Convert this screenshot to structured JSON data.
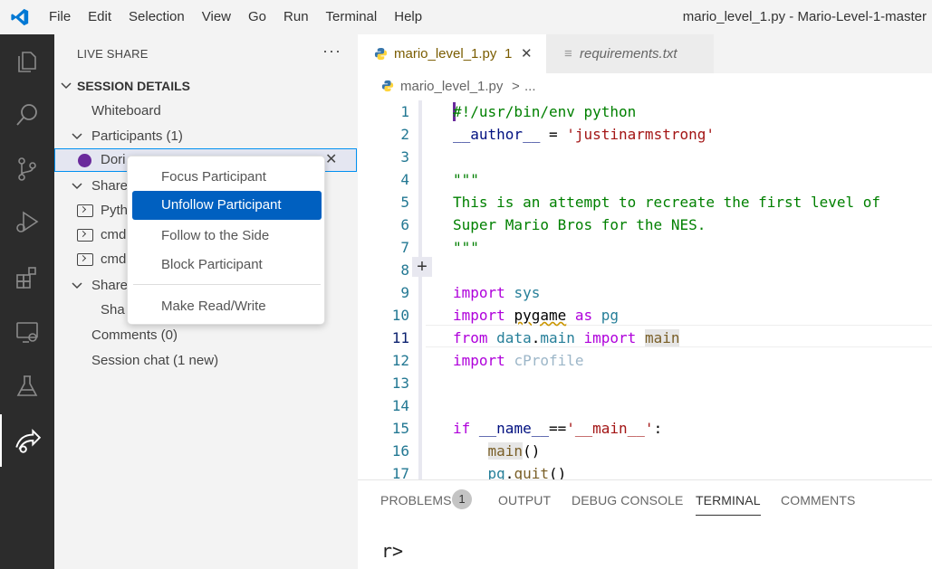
{
  "titlebar": {
    "menu": [
      "File",
      "Edit",
      "Selection",
      "View",
      "Go",
      "Run",
      "Terminal",
      "Help"
    ],
    "window_title": "mario_level_1.py - Mario-Level-1-master"
  },
  "activity_bar": {
    "icons": [
      "explorer-icon",
      "search-icon",
      "source-control-icon",
      "run-debug-icon",
      "extensions-icon",
      "remote-explorer-icon",
      "testing-icon",
      "live-share-icon"
    ],
    "active": "live-share-icon"
  },
  "sidebar": {
    "title": "LIVE SHARE",
    "more": "···",
    "section": "SESSION DETAILS",
    "whiteboard": "Whiteboard",
    "participants": "Participants (1)",
    "participant_name": "Dori",
    "shared_servers": "Share",
    "terminal_items": [
      "Pyth",
      "cmd",
      "cmd"
    ],
    "shared_group": "Share",
    "shared_item": "Sha",
    "comments": "Comments (0)",
    "session_chat": "Session chat (1 new)",
    "close": "✕"
  },
  "context_menu": {
    "items": [
      "Focus Participant",
      "Unfollow Participant",
      "Follow to the Side",
      "Block Participant",
      "Make Read/Write"
    ],
    "highlighted": "Unfollow Participant"
  },
  "tabs": [
    {
      "label": "mario_level_1.py",
      "badge": "1",
      "close": "✕"
    },
    {
      "label": "requirements.txt"
    }
  ],
  "breadcrumb": {
    "file": "mario_level_1.py",
    "sep": ">",
    "rest": "..."
  },
  "editor": {
    "line_numbers": [
      "1",
      "2",
      "3",
      "4",
      "5",
      "6",
      "7",
      "8",
      "9",
      "10",
      "11",
      "12",
      "13",
      "14",
      "15",
      "16",
      "17"
    ],
    "current_line": "11"
  },
  "panel": {
    "tabs": [
      "PROBLEMS",
      "OUTPUT",
      "DEBUG CONSOLE",
      "TERMINAL",
      "COMMENTS"
    ],
    "problems_count": "1",
    "active": "TERMINAL",
    "prompt": "r>"
  },
  "colors": {
    "activity_bg": "#2c2c2c",
    "menu_highlight": "#0060c0",
    "participant_dot": "#6a2a9c",
    "selection_outline": "#0090f1"
  }
}
